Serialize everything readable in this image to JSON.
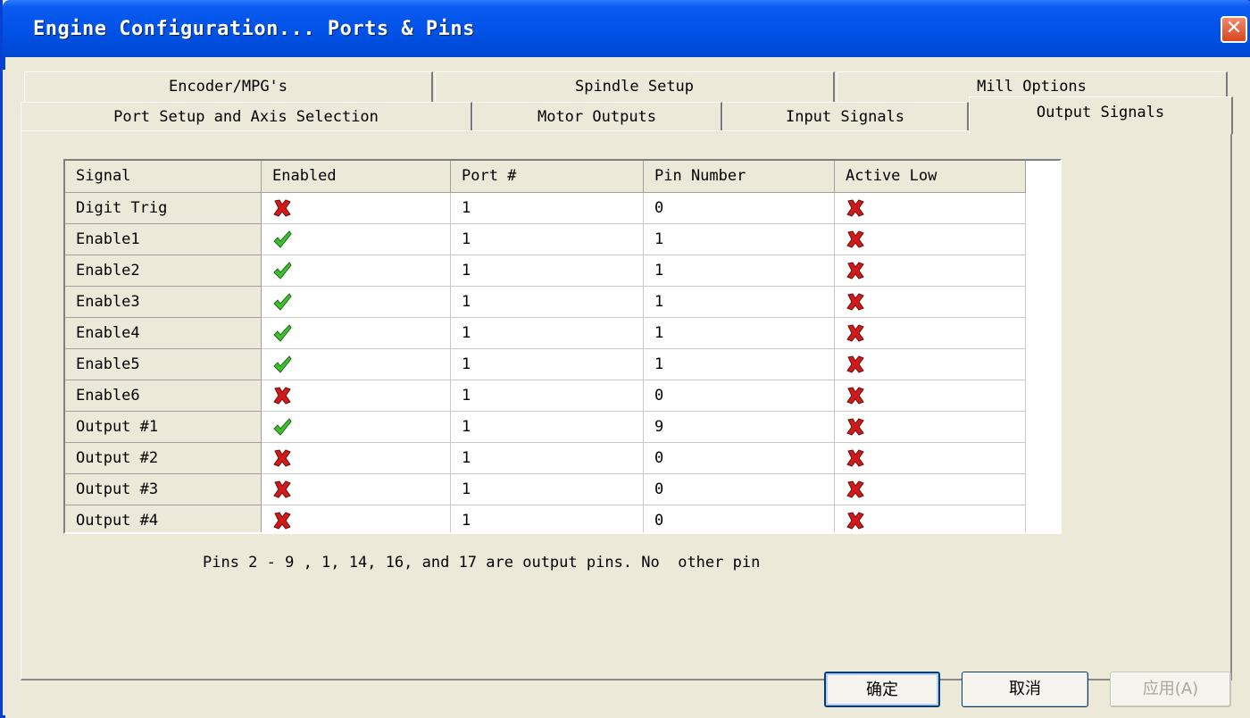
{
  "window": {
    "title": "Engine Configuration... Ports & Pins",
    "close_label": "✕"
  },
  "tabs": {
    "back_row": [
      "Encoder/MPG's",
      "Spindle Setup",
      "Mill Options"
    ],
    "front_row": [
      "Port Setup and Axis Selection",
      "Motor Outputs",
      "Input Signals",
      "Output Signals"
    ],
    "active": "Output Signals"
  },
  "grid": {
    "columns": [
      "Signal",
      "Enabled",
      "Port #",
      "Pin Number",
      "Active Low"
    ],
    "rows": [
      {
        "signal": "Digit  Trig",
        "enabled": false,
        "port": "1",
        "pin": "0",
        "active_low": false
      },
      {
        "signal": "Enable1",
        "enabled": true,
        "port": "1",
        "pin": "1",
        "active_low": false
      },
      {
        "signal": "Enable2",
        "enabled": true,
        "port": "1",
        "pin": "1",
        "active_low": false
      },
      {
        "signal": "Enable3",
        "enabled": true,
        "port": "1",
        "pin": "1",
        "active_low": false
      },
      {
        "signal": "Enable4",
        "enabled": true,
        "port": "1",
        "pin": "1",
        "active_low": false
      },
      {
        "signal": "Enable5",
        "enabled": true,
        "port": "1",
        "pin": "1",
        "active_low": false
      },
      {
        "signal": "Enable6",
        "enabled": false,
        "port": "1",
        "pin": "0",
        "active_low": false
      },
      {
        "signal": "Output #1",
        "enabled": true,
        "port": "1",
        "pin": "9",
        "active_low": false
      },
      {
        "signal": "Output #2",
        "enabled": false,
        "port": "1",
        "pin": "0",
        "active_low": false
      },
      {
        "signal": "Output #3",
        "enabled": false,
        "port": "1",
        "pin": "0",
        "active_low": false
      },
      {
        "signal": "Output #4",
        "enabled": false,
        "port": "1",
        "pin": "0",
        "active_low": false
      }
    ],
    "icons": {
      "true": "check-icon",
      "false": "x-icon"
    },
    "colors": {
      "check": "#3fbf2f",
      "x": "#d21a1a"
    }
  },
  "note": "Pins 2 - 9 , 1, 14, 16, and 17 are output pins. No  other pin",
  "buttons": {
    "ok": "确定",
    "cancel": "取消",
    "apply": "应用(A)"
  }
}
